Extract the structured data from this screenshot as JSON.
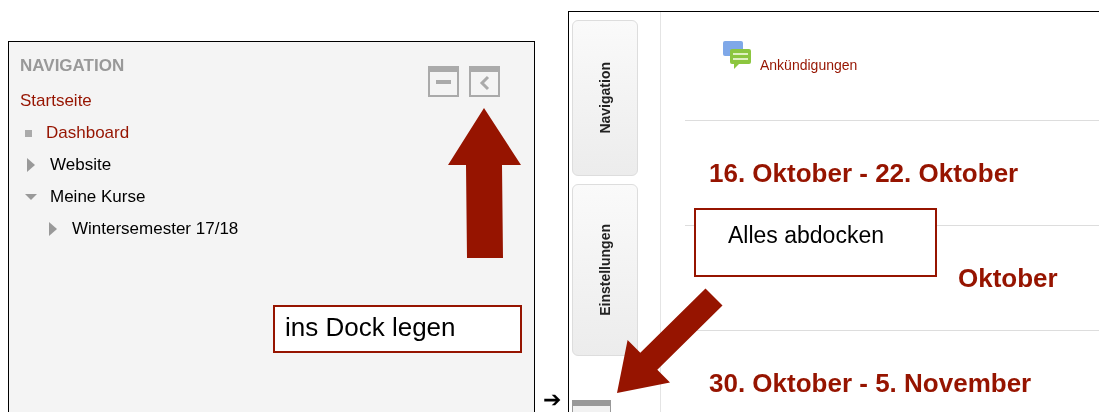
{
  "navigation_block": {
    "title": "NAVIGATION",
    "items": [
      {
        "label": "Startseite",
        "kind": "home",
        "children": [
          {
            "label": "Dashboard",
            "kind": "leaf"
          },
          {
            "label": "Website",
            "kind": "branch",
            "expanded": false
          },
          {
            "label": "Meine Kurse",
            "kind": "branch",
            "expanded": true,
            "children": [
              {
                "label": "Wintersemester 17/18",
                "kind": "branch",
                "expanded": false
              }
            ]
          }
        ]
      }
    ],
    "callout": "ins Dock legen"
  },
  "separator_arrow": "➔",
  "course_page": {
    "dock_tabs": [
      {
        "label": "Navigation"
      },
      {
        "label": "Einstellungen"
      }
    ],
    "activity": "Ankündigungen",
    "sections": [
      {
        "title": "16. Oktober - 22. Oktober",
        "kind": "full"
      },
      {
        "title": "Oktober",
        "kind": "partial"
      },
      {
        "title": "30. Oktober - 5. November",
        "kind": "full"
      }
    ],
    "callout": "Alles abdocken"
  }
}
